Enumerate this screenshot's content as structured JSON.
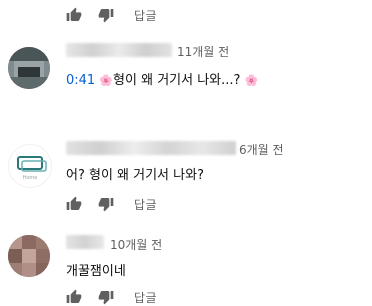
{
  "actions": {
    "reply_label": "답글"
  },
  "comments": [
    {
      "time": "11개월 전",
      "timestamp_link": "0:41",
      "prefix_emoji": "🌸",
      "text": "형이 왜 거기서 나와...?",
      "suffix_emoji": "🌸"
    },
    {
      "time": "6개월 전",
      "text": "어? 형이 왜 거기서 나와?",
      "avatar_text": "Home"
    },
    {
      "time": "10개월 전",
      "text": "개꿀잼이네"
    }
  ],
  "icons": {
    "like": "thumbs-up-icon",
    "dislike": "thumbs-down-icon"
  },
  "colors": {
    "link": "#065fd4",
    "secondary_text": "#606060",
    "emoji": "#e05b96"
  }
}
